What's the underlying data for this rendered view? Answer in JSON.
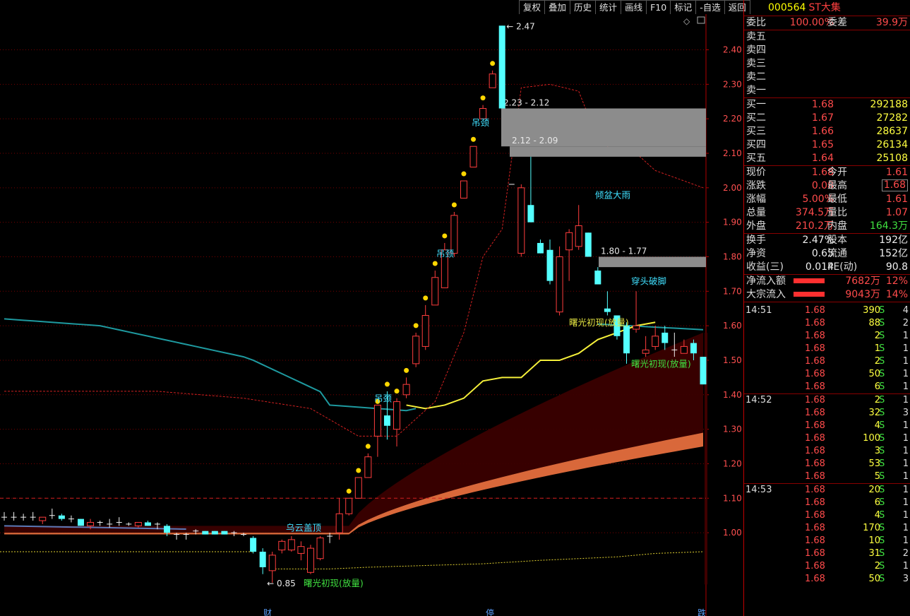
{
  "toolbar": {
    "buttons": [
      "复权",
      "叠加",
      "历史",
      "统计",
      "画线",
      "F10",
      "标记",
      "-自选",
      "返回"
    ]
  },
  "stock": {
    "code": "000564",
    "name": "ST大集"
  },
  "quote": {
    "weibi_label": "委比",
    "weibi": "100.00%",
    "weicha_label": "委差",
    "weicha": "39.9万",
    "sells": [
      {
        "label": "卖五",
        "price": "",
        "vol": ""
      },
      {
        "label": "卖四",
        "price": "",
        "vol": ""
      },
      {
        "label": "卖三",
        "price": "",
        "vol": ""
      },
      {
        "label": "卖二",
        "price": "",
        "vol": ""
      },
      {
        "label": "卖一",
        "price": "",
        "vol": ""
      }
    ],
    "buys": [
      {
        "label": "买一",
        "price": "1.68",
        "vol": "292188"
      },
      {
        "label": "买二",
        "price": "1.67",
        "vol": "27282"
      },
      {
        "label": "买三",
        "price": "1.66",
        "vol": "28637"
      },
      {
        "label": "买四",
        "price": "1.65",
        "vol": "26134"
      },
      {
        "label": "买五",
        "price": "1.64",
        "vol": "25108"
      }
    ],
    "stats": [
      {
        "l1": "现价",
        "v1": "1.68",
        "c1": "red",
        "l2": "今开",
        "v2": "1.61",
        "c2": "red",
        "box": false
      },
      {
        "l1": "涨跌",
        "v1": "0.08",
        "c1": "red",
        "l2": "最高",
        "v2": "1.68",
        "c2": "red",
        "box": true
      },
      {
        "l1": "涨幅",
        "v1": "5.00%",
        "c1": "red",
        "l2": "最低",
        "v2": "1.61",
        "c2": "red",
        "box": false
      },
      {
        "l1": "总量",
        "v1": "374.5万",
        "c1": "red",
        "l2": "量比",
        "v2": "1.07",
        "c2": "red",
        "box": false
      },
      {
        "l1": "外盘",
        "v1": "210.2万",
        "c1": "red",
        "l2": "内盘",
        "v2": "164.3万",
        "c2": "grn",
        "box": false
      }
    ],
    "stats2": [
      {
        "l1": "换手",
        "v1": "2.47%",
        "l2": "股本",
        "v2": "192亿"
      },
      {
        "l1": "净资",
        "v1": "0.65",
        "l2": "流通",
        "v2": "152亿"
      },
      {
        "l1": "收益(三)",
        "v1": "0.014",
        "l2": "PE(动)",
        "v2": "90.8"
      }
    ],
    "flows": [
      {
        "label": "净流入额",
        "value": "7682万",
        "pct": "12%"
      },
      {
        "label": "大宗流入",
        "value": "9043万",
        "pct": "14%"
      }
    ]
  },
  "ticks": [
    {
      "time": "14:51",
      "price": "1.68",
      "vol": "390",
      "side": "S",
      "n": "4"
    },
    {
      "time": "",
      "price": "1.68",
      "vol": "88",
      "side": "S",
      "n": "2"
    },
    {
      "time": "",
      "price": "1.68",
      "vol": "2",
      "side": "S",
      "n": "1"
    },
    {
      "time": "",
      "price": "1.68",
      "vol": "1",
      "side": "S",
      "n": "1"
    },
    {
      "time": "",
      "price": "1.68",
      "vol": "2",
      "side": "S",
      "n": "1"
    },
    {
      "time": "",
      "price": "1.68",
      "vol": "50",
      "side": "S",
      "n": "1"
    },
    {
      "time": "",
      "price": "1.68",
      "vol": "6",
      "side": "S",
      "n": "1"
    },
    {
      "time": "14:52",
      "price": "1.68",
      "vol": "2",
      "side": "S",
      "n": "1"
    },
    {
      "time": "",
      "price": "1.68",
      "vol": "32",
      "side": "S",
      "n": "3"
    },
    {
      "time": "",
      "price": "1.68",
      "vol": "4",
      "side": "S",
      "n": "1"
    },
    {
      "time": "",
      "price": "1.68",
      "vol": "100",
      "side": "S",
      "n": "1"
    },
    {
      "time": "",
      "price": "1.68",
      "vol": "3",
      "side": "S",
      "n": "1"
    },
    {
      "time": "",
      "price": "1.68",
      "vol": "53",
      "side": "S",
      "n": "1"
    },
    {
      "time": "",
      "price": "1.68",
      "vol": "5",
      "side": "S",
      "n": "1"
    },
    {
      "time": "14:53",
      "price": "1.68",
      "vol": "20",
      "side": "S",
      "n": "1"
    },
    {
      "time": "",
      "price": "1.68",
      "vol": "6",
      "side": "S",
      "n": "1"
    },
    {
      "time": "",
      "price": "1.68",
      "vol": "4",
      "side": "S",
      "n": "1"
    },
    {
      "time": "",
      "price": "1.68",
      "vol": "170",
      "side": "S",
      "n": "1"
    },
    {
      "time": "",
      "price": "1.68",
      "vol": "10",
      "side": "S",
      "n": "1"
    },
    {
      "time": "",
      "price": "1.68",
      "vol": "31",
      "side": "S",
      "n": "2"
    },
    {
      "time": "",
      "price": "1.68",
      "vol": "2",
      "side": "S",
      "n": "1"
    },
    {
      "time": "",
      "price": "1.68",
      "vol": "50",
      "side": "S",
      "n": "3"
    }
  ],
  "chart_data": {
    "type": "candlestick",
    "y_ticks": [
      "2.40",
      "2.30",
      "2.20",
      "2.10",
      "2.00",
      "1.90",
      "1.80",
      "1.70",
      "1.60",
      "1.50",
      "1.40",
      "1.30",
      "1.20",
      "1.10",
      "1.00"
    ],
    "ylim": [
      0.85,
      2.47
    ],
    "max_label": "2.47",
    "min_label": "0.85",
    "gaps": [
      {
        "label": "2.23 - 2.12",
        "low": 2.12,
        "high": 2.23
      },
      {
        "label": "2.12 - 2.09",
        "low": 2.09,
        "high": 2.12
      },
      {
        "label": "1.80 - 1.77",
        "low": 1.77,
        "high": 1.8
      }
    ],
    "pattern_labels": [
      "吊颈",
      "吊颈",
      "吊颈",
      "倾盆大雨",
      "穿头破脚",
      "曙光初现(放量)",
      "曙光初现(放量)",
      "乌云盖顶",
      "曙光初现(放量)"
    ],
    "bottom_marks": [
      "财",
      "停",
      "跌"
    ],
    "candles": [
      {
        "o": 1.045,
        "h": 1.06,
        "l": 1.035,
        "c": 1.045
      },
      {
        "o": 1.045,
        "h": 1.06,
        "l": 1.035,
        "c": 1.045
      },
      {
        "o": 1.045,
        "h": 1.055,
        "l": 1.035,
        "c": 1.045
      },
      {
        "o": 1.045,
        "h": 1.06,
        "l": 1.035,
        "c": 1.045
      },
      {
        "o": 1.035,
        "h": 1.045,
        "l": 1.025,
        "c": 1.045
      },
      {
        "o": 1.05,
        "h": 1.07,
        "l": 1.04,
        "c": 1.05
      },
      {
        "o": 1.05,
        "h": 1.055,
        "l": 1.035,
        "c": 1.04
      },
      {
        "o": 1.04,
        "h": 1.05,
        "l": 1.03,
        "c": 1.04
      },
      {
        "o": 1.04,
        "h": 1.04,
        "l": 1.02,
        "c": 1.02
      },
      {
        "o": 1.02,
        "h": 1.04,
        "l": 1.01,
        "c": 1.03
      },
      {
        "o": 1.025,
        "h": 1.035,
        "l": 1.02,
        "c": 1.03
      },
      {
        "o": 1.025,
        "h": 1.04,
        "l": 1.015,
        "c": 1.025
      },
      {
        "o": 1.03,
        "h": 1.045,
        "l": 1.02,
        "c": 1.025
      },
      {
        "o": 1.025,
        "h": 1.03,
        "l": 1.02,
        "c": 1.02
      },
      {
        "o": 1.02,
        "h": 1.03,
        "l": 1.015,
        "c": 1.03
      },
      {
        "o": 1.03,
        "h": 1.035,
        "l": 1.02,
        "c": 1.02
      },
      {
        "o": 1.025,
        "h": 1.03,
        "l": 1.01,
        "c": 1.02
      },
      {
        "o": 1.02,
        "h": 1.025,
        "l": 0.99,
        "c": 1.0
      },
      {
        "o": 0.995,
        "h": 1.0,
        "l": 0.98,
        "c": 0.995
      },
      {
        "o": 0.995,
        "h": 1.0,
        "l": 0.98,
        "c": 0.995
      },
      {
        "o": 1.0,
        "h": 1.01,
        "l": 0.995,
        "c": 1.005
      },
      {
        "o": 1.005,
        "h": 1.005,
        "l": 0.995,
        "c": 0.995
      },
      {
        "o": 1.005,
        "h": 1.005,
        "l": 0.995,
        "c": 0.995
      },
      {
        "o": 1.005,
        "h": 1.005,
        "l": 0.995,
        "c": 0.995
      },
      {
        "o": 1.0,
        "h": 1.005,
        "l": 0.99,
        "c": 0.995
      },
      {
        "o": 0.995,
        "h": 1.0,
        "l": 0.99,
        "c": 0.995
      },
      {
        "o": 0.985,
        "h": 0.99,
        "l": 0.94,
        "c": 0.945
      },
      {
        "o": 0.945,
        "h": 0.955,
        "l": 0.88,
        "c": 0.9
      },
      {
        "o": 0.89,
        "h": 0.945,
        "l": 0.855,
        "c": 0.935
      },
      {
        "o": 0.95,
        "h": 0.98,
        "l": 0.94,
        "c": 0.975
      },
      {
        "o": 0.95,
        "h": 0.99,
        "l": 0.945,
        "c": 0.98
      },
      {
        "o": 0.94,
        "h": 0.975,
        "l": 0.92,
        "c": 0.96
      },
      {
        "o": 0.885,
        "h": 0.965,
        "l": 0.88,
        "c": 0.955
      },
      {
        "o": 0.925,
        "h": 0.99,
        "l": 0.92,
        "c": 0.985
      },
      {
        "o": 0.99,
        "h": 1.0,
        "l": 0.97,
        "c": 0.99
      },
      {
        "o": 1.0,
        "h": 1.1,
        "l": 0.98,
        "c": 1.055
      },
      {
        "o": 1.055,
        "h": 1.1,
        "l": 1.05,
        "c": 1.1
      },
      {
        "o": 1.1,
        "h": 1.16,
        "l": 1.1,
        "c": 1.16
      },
      {
        "o": 1.16,
        "h": 1.23,
        "l": 1.16,
        "c": 1.22
      },
      {
        "o": 1.28,
        "h": 1.36,
        "l": 1.22,
        "c": 1.37
      },
      {
        "o": 1.34,
        "h": 1.41,
        "l": 1.27,
        "c": 1.31
      },
      {
        "o": 1.3,
        "h": 1.39,
        "l": 1.25,
        "c": 1.38
      },
      {
        "o": 1.4,
        "h": 1.45,
        "l": 1.39,
        "c": 1.43
      },
      {
        "o": 1.49,
        "h": 1.58,
        "l": 1.48,
        "c": 1.57
      },
      {
        "o": 1.54,
        "h": 1.66,
        "l": 1.53,
        "c": 1.63
      },
      {
        "o": 1.66,
        "h": 1.76,
        "l": 1.66,
        "c": 1.74
      },
      {
        "o": 1.71,
        "h": 1.84,
        "l": 1.71,
        "c": 1.82
      },
      {
        "o": 1.81,
        "h": 1.93,
        "l": 1.8,
        "c": 1.92
      },
      {
        "o": 1.97,
        "h": 2.02,
        "l": 1.97,
        "c": 2.02
      },
      {
        "o": 2.06,
        "h": 2.12,
        "l": 2.06,
        "c": 2.12
      },
      {
        "o": 2.2,
        "h": 2.24,
        "l": 2.2,
        "c": 2.23
      },
      {
        "o": 2.29,
        "h": 2.34,
        "l": 2.29,
        "c": 2.33
      },
      {
        "o": 2.47,
        "h": 2.47,
        "l": 2.23,
        "c": 2.23
      },
      {
        "o": 2.01,
        "h": 2.01,
        "l": 2.01,
        "c": 2.01
      },
      {
        "o": 1.81,
        "h": 2.01,
        "l": 1.8,
        "c": 2.0
      },
      {
        "o": 1.95,
        "h": 2.09,
        "l": 1.9,
        "c": 1.9
      },
      {
        "o": 1.84,
        "h": 1.85,
        "l": 1.81,
        "c": 1.81
      },
      {
        "o": 1.82,
        "h": 1.85,
        "l": 1.72,
        "c": 1.73
      },
      {
        "o": 1.64,
        "h": 1.83,
        "l": 1.63,
        "c": 1.8
      },
      {
        "o": 1.82,
        "h": 1.88,
        "l": 1.73,
        "c": 1.87
      },
      {
        "o": 1.83,
        "h": 1.95,
        "l": 1.82,
        "c": 1.89
      },
      {
        "o": 1.87,
        "h": 1.87,
        "l": 1.8,
        "c": 1.8
      },
      {
        "o": 1.76,
        "h": 1.77,
        "l": 1.72,
        "c": 1.72
      },
      {
        "o": 1.65,
        "h": 1.7,
        "l": 1.63,
        "c": 1.64
      },
      {
        "o": 1.63,
        "h": 1.63,
        "l": 1.56,
        "c": 1.57
      },
      {
        "o": 1.6,
        "h": 1.61,
        "l": 1.49,
        "c": 1.52
      },
      {
        "o": 1.59,
        "h": 1.7,
        "l": 1.58,
        "c": 1.6
      },
      {
        "o": 1.52,
        "h": 1.57,
        "l": 1.51,
        "c": 1.53
      },
      {
        "o": 1.54,
        "h": 1.6,
        "l": 1.53,
        "c": 1.57
      },
      {
        "o": 1.58,
        "h": 1.6,
        "l": 1.53,
        "c": 1.55
      },
      {
        "o": 1.53,
        "h": 1.58,
        "l": 1.51,
        "c": 1.53
      },
      {
        "o": 1.52,
        "h": 1.56,
        "l": 1.52,
        "c": 1.54
      },
      {
        "o": 1.55,
        "h": 1.56,
        "l": 1.5,
        "c": 1.52
      },
      {
        "o": 1.51,
        "h": 1.51,
        "l": 1.43,
        "c": 1.43
      }
    ]
  }
}
